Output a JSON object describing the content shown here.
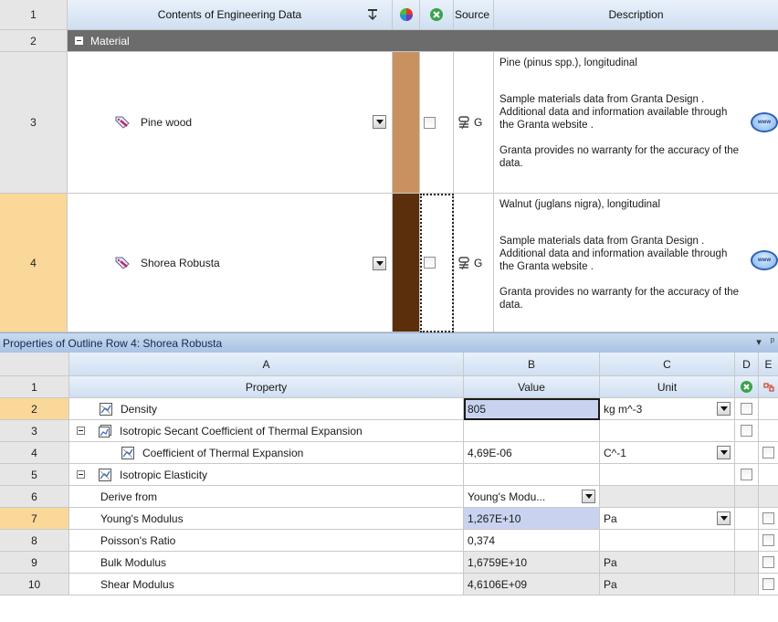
{
  "outline": {
    "header": {
      "row_number": "1",
      "contents_label": "Contents of Engineering Data",
      "source_label": "Source",
      "description_label": "Description"
    },
    "material_group": {
      "row_number": "2",
      "label": "Material"
    },
    "materials": [
      {
        "row_number": "3",
        "name": "Pine wood",
        "color": "#c8915f",
        "source_text": "G",
        "description": [
          "Pine (pinus spp.), longitudinal",
          "Sample materials data from Granta Design . Additional data and information available through the Granta website .",
          "Granta provides no warranty for the accuracy of the data."
        ]
      },
      {
        "row_number": "4",
        "name": "Shorea Robusta",
        "color": "#5b2f0b",
        "source_text": "G",
        "description": [
          "Walnut (juglans nigra), longitudinal",
          "Sample materials data from Granta Design . Additional data and information available through the Granta website .",
          "Granta provides no warranty for the accuracy of the data."
        ]
      }
    ],
    "www_icon_label": "www"
  },
  "properties": {
    "title": "Properties of Outline Row 4: Shorea Robusta",
    "title_buttons": [
      "▾",
      "ᵖ"
    ],
    "columns": {
      "a": "A",
      "b": "B",
      "c": "C",
      "d": "D",
      "e": "E"
    },
    "header_row": {
      "number": "1",
      "property": "Property",
      "value": "Value",
      "unit": "Unit"
    },
    "rows": [
      {
        "number": "2",
        "property": "Density",
        "value": "805",
        "unit": "kg m^-3"
      },
      {
        "number": "3",
        "property": "Isotropic Secant Coefficient of Thermal Expansion",
        "value": "",
        "unit": ""
      },
      {
        "number": "4",
        "property": "Coefficient of Thermal Expansion",
        "value": "4,69E-06",
        "unit": "C^-1"
      },
      {
        "number": "5",
        "property": "Isotropic Elasticity",
        "value": "",
        "unit": ""
      },
      {
        "number": "6",
        "property": "Derive from",
        "value": "Young's Modu...",
        "unit": ""
      },
      {
        "number": "7",
        "property": "Young's Modulus",
        "value": "1,267E+10",
        "unit": "Pa"
      },
      {
        "number": "8",
        "property": "Poisson's Ratio",
        "value": "0,374",
        "unit": ""
      },
      {
        "number": "9",
        "property": "Bulk Modulus",
        "value": "1,6759E+10",
        "unit": "Pa"
      },
      {
        "number": "10",
        "property": "Shear Modulus",
        "value": "4,6106E+09",
        "unit": "Pa"
      }
    ]
  },
  "colors": {
    "header_gradient_top": "#e9f1fb",
    "header_gradient_bottom": "#cfdff1",
    "selected_row": "#f9d89a",
    "value_highlight": "#c9d3ef",
    "material_header": "#6c6c6c"
  }
}
